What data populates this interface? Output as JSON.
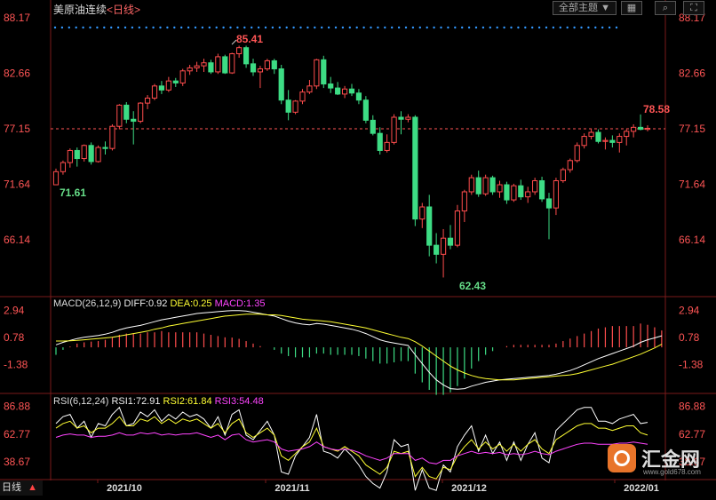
{
  "header": {
    "title": "美原油连续",
    "period": "<日线>",
    "theme_button": "全部主题",
    "theme_arrow": "▼"
  },
  "colors": {
    "up": "#ff4d4d",
    "down": "#3ddc84",
    "price_label": "#ff5555",
    "axis_line": "#7a1a1a",
    "dif_line": "#ffffff",
    "dea_line": "#ffff33",
    "rsi1": "#ffffff",
    "rsi2": "#ffff33",
    "rsi3": "#ff44ff"
  },
  "main_axis": {
    "ticks": [
      "88.17",
      "82.66",
      "77.15",
      "71.64",
      "66.14"
    ],
    "current_price_line": 77.15
  },
  "annotations": {
    "high": "85.41",
    "low": "62.43",
    "start_low": "71.61",
    "last_high": "78.58"
  },
  "macd": {
    "label": "MACD(26,12,9)",
    "diff_label": "DIFF:0.92",
    "dea_label": "DEA:0.25",
    "macd_label": "MACD:1.35",
    "ticks": [
      "2.94",
      "0.78",
      "-1.38"
    ]
  },
  "rsi": {
    "label": "RSI(6,12,24)",
    "rsi1_label": "RSI1:72.91",
    "rsi2_label": "RSI2:61.84",
    "rsi3_label": "RSI3:54.48",
    "ticks": [
      "86.88",
      "62.77",
      "38.67"
    ]
  },
  "x_axis": {
    "labels": [
      "2021/10",
      "2021/11",
      "2021/12",
      "2022/01"
    ]
  },
  "footer": {
    "period_tab": "日线",
    "arrow": "▲"
  },
  "watermark": {
    "brand": "汇金网",
    "url": "www.gold678.com"
  },
  "chart_data": [
    {
      "type": "candlestick",
      "title": "美原油连续 日线",
      "ylim": [
        62.0,
        88.17
      ],
      "x_period": "2021/09 – 2022/01",
      "candles": [
        [
          71.6,
          73.2,
          71.6,
          72.9
        ],
        [
          72.9,
          74.0,
          72.6,
          73.8
        ],
        [
          73.8,
          75.2,
          73.3,
          75.0
        ],
        [
          75.0,
          75.3,
          73.4,
          74.2
        ],
        [
          74.2,
          75.6,
          73.9,
          75.5
        ],
        [
          75.5,
          75.8,
          73.6,
          73.9
        ],
        [
          73.9,
          75.5,
          73.8,
          75.3
        ],
        [
          75.3,
          75.9,
          74.6,
          75.2
        ],
        [
          75.2,
          77.6,
          75.0,
          77.4
        ],
        [
          77.4,
          79.6,
          77.1,
          79.5
        ],
        [
          79.5,
          79.8,
          77.7,
          78.1
        ],
        [
          78.1,
          78.9,
          75.6,
          77.9
        ],
        [
          77.9,
          79.8,
          77.7,
          79.7
        ],
        [
          79.7,
          80.5,
          79.1,
          80.2
        ],
        [
          80.2,
          81.6,
          80.0,
          81.4
        ],
        [
          81.4,
          81.9,
          80.6,
          81.0
        ],
        [
          81.0,
          82.3,
          80.8,
          81.9
        ],
        [
          81.9,
          82.2,
          81.3,
          81.7
        ],
        [
          81.7,
          83.1,
          81.4,
          82.9
        ],
        [
          82.9,
          83.5,
          82.5,
          83.2
        ],
        [
          83.2,
          83.8,
          82.8,
          83.4
        ],
        [
          83.4,
          84.1,
          82.8,
          83.7
        ],
        [
          83.7,
          84.0,
          82.6,
          82.8
        ],
        [
          82.8,
          84.6,
          82.6,
          84.3
        ],
        [
          84.3,
          84.5,
          82.6,
          82.7
        ],
        [
          82.7,
          84.7,
          82.6,
          84.6
        ],
        [
          84.6,
          85.4,
          84.2,
          85.2
        ],
        [
          85.2,
          85.4,
          83.2,
          83.6
        ],
        [
          83.6,
          84.1,
          82.4,
          82.8
        ],
        [
          82.8,
          83.4,
          81.2,
          83.1
        ],
        [
          83.1,
          84.1,
          82.9,
          83.9
        ],
        [
          83.9,
          84.1,
          82.6,
          83.1
        ],
        [
          83.1,
          83.5,
          79.6,
          80.0
        ],
        [
          80.0,
          81.0,
          78.0,
          78.8
        ],
        [
          78.8,
          80.0,
          78.6,
          79.9
        ],
        [
          79.9,
          81.1,
          79.6,
          80.8
        ],
        [
          80.8,
          82.0,
          80.6,
          81.4
        ],
        [
          81.4,
          84.1,
          81.1,
          84.0
        ],
        [
          84.0,
          84.4,
          81.2,
          81.6
        ],
        [
          81.6,
          82.3,
          80.7,
          81.2
        ],
        [
          81.2,
          81.8,
          80.5,
          80.6
        ],
        [
          80.6,
          81.4,
          80.2,
          81.1
        ],
        [
          81.1,
          81.6,
          80.4,
          80.7
        ],
        [
          80.7,
          81.1,
          79.6,
          80.0
        ],
        [
          80.0,
          80.4,
          77.7,
          78.0
        ],
        [
          78.0,
          78.5,
          76.5,
          76.7
        ],
        [
          76.7,
          77.3,
          74.6,
          75.0
        ],
        [
          75.0,
          76.6,
          74.8,
          75.8
        ],
        [
          75.8,
          78.6,
          75.6,
          78.3
        ],
        [
          78.3,
          78.9,
          76.6,
          78.1
        ],
        [
          78.1,
          78.6,
          77.8,
          78.3
        ],
        [
          78.3,
          78.5,
          67.5,
          68.2
        ],
        [
          68.2,
          69.8,
          67.3,
          69.4
        ],
        [
          69.4,
          70.6,
          64.5,
          65.6
        ],
        [
          65.6,
          66.8,
          63.8,
          64.7
        ],
        [
          64.7,
          67.2,
          62.4,
          66.3
        ],
        [
          66.3,
          67.6,
          65.2,
          65.6
        ],
        [
          65.6,
          69.6,
          65.4,
          69.0
        ],
        [
          69.0,
          71.1,
          67.9,
          70.9
        ],
        [
          70.9,
          72.6,
          70.6,
          72.3
        ],
        [
          72.3,
          73.0,
          70.4,
          70.7
        ],
        [
          70.7,
          72.6,
          70.5,
          72.3
        ],
        [
          72.3,
          72.5,
          70.6,
          70.9
        ],
        [
          70.9,
          72.0,
          70.3,
          71.6
        ],
        [
          71.6,
          71.9,
          69.7,
          70.1
        ],
        [
          70.1,
          71.7,
          69.9,
          71.5
        ],
        [
          71.5,
          72.1,
          70.1,
          70.4
        ],
        [
          70.4,
          71.4,
          69.8,
          70.9
        ],
        [
          70.9,
          72.3,
          70.6,
          72.0
        ],
        [
          72.0,
          72.4,
          69.9,
          70.2
        ],
        [
          70.2,
          70.8,
          66.2,
          69.3
        ],
        [
          69.3,
          72.3,
          68.6,
          72.0
        ],
        [
          72.0,
          73.3,
          71.8,
          73.1
        ],
        [
          73.1,
          74.2,
          72.8,
          74.0
        ],
        [
          74.0,
          75.8,
          73.8,
          75.5
        ],
        [
          75.5,
          76.7,
          75.2,
          76.4
        ],
        [
          76.4,
          77.2,
          76.1,
          76.8
        ],
        [
          76.8,
          77.1,
          75.7,
          75.9
        ],
        [
          75.9,
          76.3,
          75.1,
          76.0
        ],
        [
          76.0,
          76.5,
          75.3,
          75.8
        ],
        [
          75.8,
          76.7,
          74.8,
          76.4
        ],
        [
          76.4,
          77.1,
          75.5,
          76.9
        ],
        [
          76.9,
          77.6,
          76.3,
          77.3
        ],
        [
          77.3,
          78.58,
          77.0,
          77.1
        ],
        [
          77.1,
          77.5,
          76.9,
          77.2
        ]
      ]
    },
    {
      "type": "line",
      "title": "MACD(26,12,9)",
      "series": [
        {
          "name": "DIFF",
          "values": [
            0.2,
            0.4,
            0.55,
            0.7,
            0.8,
            0.88,
            0.95,
            1.05,
            1.2,
            1.4,
            1.55,
            1.65,
            1.75,
            1.9,
            2.05,
            2.2,
            2.3,
            2.4,
            2.5,
            2.6,
            2.7,
            2.75,
            2.8,
            2.85,
            2.9,
            2.94,
            2.94,
            2.9,
            2.8,
            2.7,
            2.6,
            2.5,
            2.3,
            2.1,
            1.95,
            1.85,
            1.8,
            1.9,
            1.85,
            1.75,
            1.65,
            1.55,
            1.45,
            1.3,
            1.1,
            0.85,
            0.6,
            0.45,
            0.35,
            0.25,
            0.15,
            -0.6,
            -1.3,
            -2.0,
            -2.6,
            -3.0,
            -3.3,
            -3.35,
            -3.3,
            -3.1,
            -2.95,
            -2.8,
            -2.7,
            -2.6,
            -2.55,
            -2.5,
            -2.45,
            -2.4,
            -2.35,
            -2.3,
            -2.25,
            -2.15,
            -2.0,
            -1.85,
            -1.65,
            -1.4,
            -1.15,
            -0.9,
            -0.7,
            -0.5,
            -0.3,
            -0.1,
            0.1,
            0.4,
            0.6,
            0.75,
            0.92
          ]
        },
        {
          "name": "DEA",
          "values": [
            0.5,
            0.5,
            0.52,
            0.55,
            0.6,
            0.65,
            0.7,
            0.75,
            0.8,
            0.9,
            1.0,
            1.1,
            1.2,
            1.3,
            1.45,
            1.55,
            1.7,
            1.8,
            1.9,
            2.0,
            2.1,
            2.2,
            2.3,
            2.4,
            2.5,
            2.55,
            2.6,
            2.65,
            2.65,
            2.65,
            2.6,
            2.6,
            2.55,
            2.45,
            2.35,
            2.25,
            2.2,
            2.15,
            2.1,
            2.05,
            1.95,
            1.85,
            1.75,
            1.65,
            1.55,
            1.4,
            1.25,
            1.1,
            0.95,
            0.8,
            0.7,
            0.45,
            0.1,
            -0.3,
            -0.7,
            -1.1,
            -1.5,
            -1.8,
            -2.05,
            -2.25,
            -2.4,
            -2.5,
            -2.55,
            -2.6,
            -2.6,
            -2.6,
            -2.55,
            -2.5,
            -2.45,
            -2.4,
            -2.35,
            -2.3,
            -2.25,
            -2.2,
            -2.1,
            -1.95,
            -1.8,
            -1.65,
            -1.5,
            -1.35,
            -1.15,
            -0.95,
            -0.75,
            -0.55,
            -0.3,
            -0.05,
            0.25
          ]
        },
        {
          "name": "MACD",
          "values": [
            -0.6,
            -0.2,
            0.06,
            0.3,
            0.4,
            0.46,
            0.5,
            0.6,
            0.8,
            1.0,
            1.1,
            1.1,
            1.1,
            1.2,
            1.2,
            1.3,
            1.2,
            1.2,
            1.2,
            1.2,
            1.2,
            1.1,
            1.0,
            0.9,
            0.8,
            0.78,
            0.68,
            0.5,
            0.3,
            0.1,
            0.0,
            -0.2,
            -0.5,
            -0.7,
            -0.8,
            -0.8,
            -0.8,
            -0.5,
            -0.5,
            -0.6,
            -0.6,
            -0.6,
            -0.6,
            -0.7,
            -0.9,
            -1.1,
            -1.3,
            -1.3,
            -1.2,
            -1.1,
            -1.1,
            -2.1,
            -2.8,
            -3.4,
            -3.8,
            -3.8,
            -3.6,
            -3.1,
            -2.5,
            -1.7,
            -1.1,
            -0.6,
            -0.3,
            0.0,
            0.1,
            0.2,
            0.2,
            0.2,
            0.2,
            0.2,
            0.2,
            0.3,
            0.5,
            0.7,
            0.9,
            1.1,
            1.3,
            1.5,
            1.6,
            1.7,
            1.7,
            1.7,
            1.7,
            1.9,
            1.8,
            1.6,
            1.35
          ]
        }
      ],
      "ylim": [
        -3.4,
        3.2
      ]
    },
    {
      "type": "line",
      "title": "RSI(6,12,24)",
      "series": [
        {
          "name": "RSI1",
          "values": [
            72,
            78,
            80,
            68,
            74,
            60,
            72,
            70,
            80,
            86,
            70,
            72,
            82,
            78,
            84,
            74,
            80,
            76,
            82,
            78,
            80,
            76,
            68,
            78,
            62,
            80,
            84,
            62,
            58,
            66,
            74,
            62,
            30,
            28,
            44,
            52,
            60,
            80,
            48,
            46,
            42,
            50,
            44,
            36,
            26,
            20,
            16,
            30,
            58,
            52,
            54,
            14,
            32,
            16,
            14,
            36,
            30,
            52,
            62,
            70,
            48,
            62,
            46,
            56,
            40,
            56,
            40,
            54,
            64,
            42,
            38,
            66,
            72,
            78,
            84,
            86,
            86,
            74,
            74,
            72,
            76,
            78,
            80,
            72,
            73
          ]
        },
        {
          "name": "RSI2",
          "values": [
            68,
            72,
            74,
            68,
            70,
            64,
            68,
            68,
            72,
            78,
            70,
            70,
            76,
            74,
            78,
            72,
            76,
            72,
            76,
            74,
            76,
            72,
            68,
            72,
            64,
            72,
            76,
            64,
            60,
            64,
            68,
            62,
            44,
            40,
            46,
            52,
            56,
            68,
            52,
            50,
            48,
            52,
            48,
            44,
            36,
            32,
            28,
            34,
            48,
            46,
            48,
            26,
            34,
            26,
            24,
            34,
            32,
            44,
            52,
            58,
            50,
            56,
            50,
            54,
            48,
            54,
            48,
            54,
            58,
            50,
            46,
            58,
            62,
            66,
            70,
            72,
            72,
            68,
            68,
            66,
            68,
            70,
            70,
            64,
            62
          ]
        },
        {
          "name": "RSI3",
          "values": [
            60,
            62,
            63,
            62,
            62,
            60,
            61,
            61,
            62,
            64,
            62,
            62,
            64,
            63,
            64,
            62,
            63,
            62,
            63,
            63,
            64,
            62,
            60,
            62,
            58,
            62,
            63,
            58,
            56,
            57,
            58,
            56,
            50,
            48,
            49,
            50,
            52,
            56,
            52,
            50,
            49,
            50,
            49,
            47,
            44,
            42,
            40,
            42,
            46,
            46,
            46,
            40,
            42,
            38,
            37,
            40,
            40,
            44,
            46,
            48,
            46,
            47,
            46,
            47,
            45,
            46,
            45,
            46,
            48,
            46,
            45,
            48,
            50,
            52,
            54,
            55,
            55,
            54,
            54,
            54,
            55,
            55,
            56,
            55,
            54
          ]
        }
      ],
      "ylim": [
        28,
        92
      ]
    }
  ]
}
